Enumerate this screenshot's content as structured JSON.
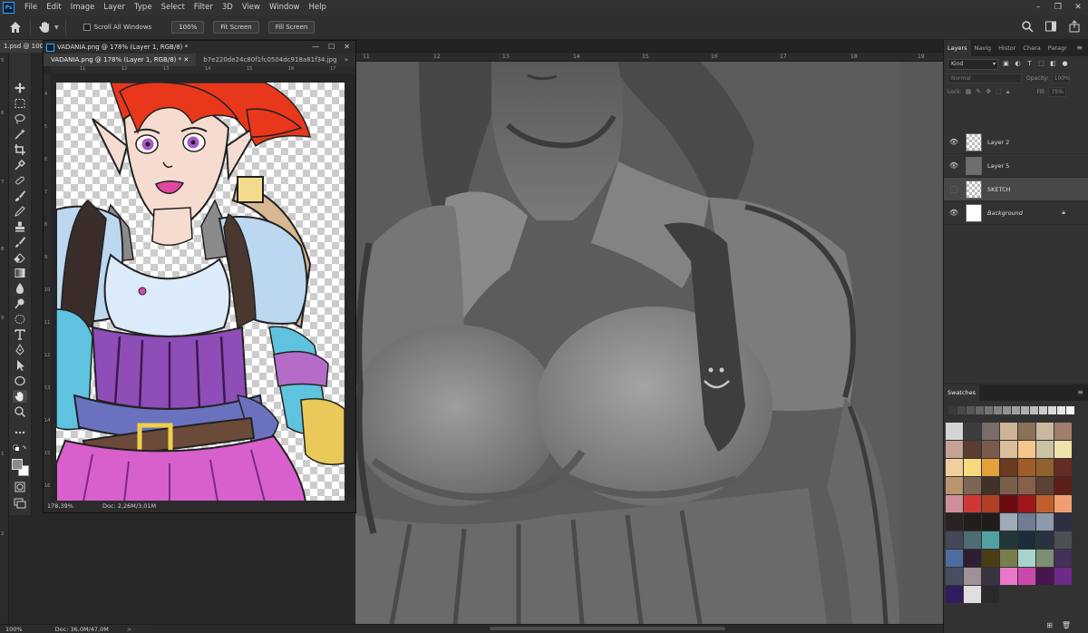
{
  "menu": [
    "File",
    "Edit",
    "Image",
    "Layer",
    "Type",
    "Select",
    "Filter",
    "3D",
    "View",
    "Window",
    "Help"
  ],
  "options": {
    "scroll_all_windows": "Scroll All Windows",
    "zoom_100": "100%",
    "fit_screen": "Fit Screen",
    "fill_screen": "Fill Screen"
  },
  "doc_tab_active": "1.psd @ 100",
  "float_window": {
    "title": "VADANIA.png @ 178% (Layer 1, RGB/8) *",
    "tabs": [
      "VADANIA.png @ 178% (Layer 1, RGB/8) *",
      "b7e220de24c80f1fc0504dc918a81f34.jpg"
    ],
    "tab_more": "»",
    "status_zoom": "178,39%",
    "status_doc": "Doc: 2,26M/3,01M",
    "hruler": [
      "11",
      "12",
      "13",
      "14",
      "15",
      "16",
      "17"
    ],
    "vruler": [
      "4",
      "5",
      "6",
      "7",
      "8",
      "9",
      "10",
      "11",
      "12",
      "13",
      "14",
      "15",
      "16"
    ]
  },
  "main_ruler": [
    "11",
    "12",
    "13",
    "14",
    "15",
    "16",
    "17",
    "18",
    "19"
  ],
  "left_ruler": [
    "5",
    "6",
    "7",
    "8",
    "9",
    "1",
    "2"
  ],
  "status": {
    "zoom": "100%",
    "doc": "Doc: 36,0M/47,0M",
    "caret": ">"
  },
  "layers_panel": {
    "tabs": [
      "Layers",
      "Navig",
      "Histor",
      "Chara",
      "Paragr"
    ],
    "kind": "Kind",
    "blend_mode": "Normal",
    "opacity_label": "Opacity:",
    "opacity_value": "100%",
    "lock_label": "Lock:",
    "fill_label": "Fill:",
    "fill_value": "75%",
    "menu": "≡",
    "layers": [
      {
        "name": "Layer 2",
        "visible": true,
        "thumb": "check"
      },
      {
        "name": "Layer 5",
        "visible": true,
        "thumb": "gray"
      },
      {
        "name": "SKETCH",
        "visible": false,
        "thumb": "check"
      },
      {
        "name": "Background",
        "visible": true,
        "thumb": "white"
      }
    ]
  },
  "swatches_panel": {
    "title": "Swatches",
    "recent": [
      "#3a3a3a",
      "#494949",
      "#575757",
      "#666666",
      "#747474",
      "#838383",
      "#929292",
      "#a0a0a0",
      "#aeaeae",
      "#bdbdbd",
      "#cbcbcb",
      "#d9d9d9",
      "#e7e7e7",
      "#f5f5f5"
    ],
    "grid": [
      "#d4d4d4",
      "#3d3d3d",
      "#7a6c6a",
      "#cdb494",
      "#8a7259",
      "#c9b8a0",
      "#a07d6c",
      "#c7a294",
      "#5a3c30",
      "#7b5a4e",
      "#d9bf9c",
      "#f7c68a",
      "#c9c2a3",
      "#efe2ab",
      "#f2ce9f",
      "#f8d97c",
      "#e3a03b",
      "#6b3a1f",
      "#a05c2b",
      "#93612e",
      "#642e24",
      "#b9946e",
      "#7c6655",
      "#413126",
      "#7a6048",
      "#87604a",
      "#5c4134",
      "#5d1f17",
      "#cd8f99",
      "#d03838",
      "#b04026",
      "#6d0c10",
      "#a0161a",
      "#c15f2a",
      "#f0a070",
      "#2b2322",
      "#231e1c",
      "#211c1c",
      "#9faab8",
      "#6e7c94",
      "#8c9aac",
      "#2e3042",
      "#46465a",
      "#4e6c74",
      "#52a1a2",
      "#223638",
      "#1d2c3a",
      "#2a3240",
      "#4c4f54",
      "#4c6e9e",
      "#2e1e32",
      "#4a3c14",
      "#777e4c",
      "#a6d4cc",
      "#7e8e74",
      "#44305a",
      "#494e60",
      "#a09098",
      "#3a3440",
      "#e878c8",
      "#c84aa8",
      "#4a1450",
      "#6e2a8a",
      "#321c60",
      "#dedede",
      "#2a2a2a"
    ]
  }
}
